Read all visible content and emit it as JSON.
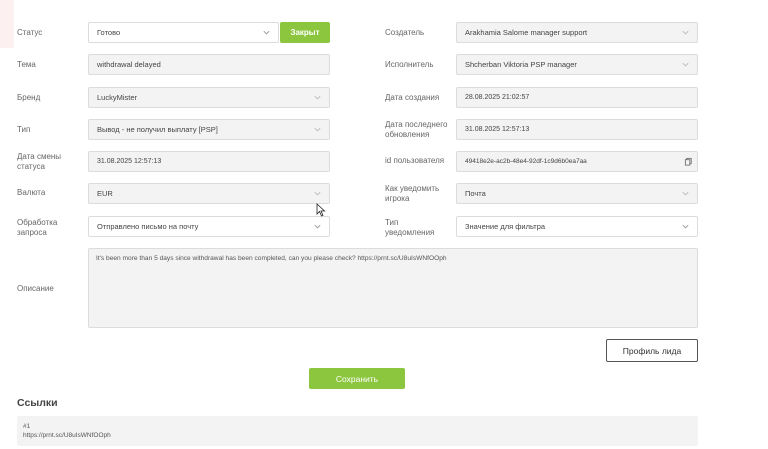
{
  "form": {
    "left": [
      {
        "label": "Статус",
        "value": "Готово",
        "dropdown": true,
        "white": true
      },
      {
        "label": "Тема",
        "value": "withdrawal delayed",
        "dropdown": false,
        "white": false
      },
      {
        "label": "Бренд",
        "value": "LuckyMister",
        "dropdown": true,
        "white": false
      },
      {
        "label": "Тип",
        "value": "Вывод - не получил выплату [PSP]",
        "dropdown": true,
        "white": false
      },
      {
        "label": "Дата смены статуса",
        "value": "31.08.2025 12:57:13",
        "dropdown": false,
        "white": false
      },
      {
        "label": "Валюта",
        "value": "EUR",
        "dropdown": true,
        "white": false
      },
      {
        "label": "Обработка запроса",
        "value": "Отправлено письмо на почту",
        "dropdown": true,
        "white": true
      }
    ],
    "right": [
      {
        "label": "Создатель",
        "value": "Arakhamia Salome manager support",
        "dropdown": true,
        "white": false
      },
      {
        "label": "Исполнитель",
        "value": "Shcherban Viktoria PSP manager",
        "dropdown": true,
        "white": false
      },
      {
        "label": "Дата создания",
        "value": "28.08.2025 21:02:57",
        "dropdown": false,
        "white": false
      },
      {
        "label": "Дата последнего обновления",
        "value": "31.08.2025 12:57:13",
        "dropdown": false,
        "white": false
      },
      {
        "label": "id пользователя",
        "value": "49418e2e-ac2b-48e4-92df-1c9d6b0ea7aa",
        "dropdown": false,
        "white": false,
        "copy": true
      },
      {
        "label": "Как уведомить игрока",
        "value": "Почта",
        "dropdown": true,
        "white": false
      },
      {
        "label": "Тип уведомления",
        "placeholder": "Значение для фильтра",
        "dropdown": true,
        "white": true
      }
    ],
    "close_button": "Закрыт",
    "description_label": "Описание",
    "description_text": "It's been more than 5 days since withdrawal has been completed, can you please check? https://prnt.sc/U8uIsWNfOOph"
  },
  "profile_button": "Профиль лида",
  "save_button": "Сохранить",
  "links": {
    "title": "Ссылки",
    "items": [
      {
        "index": "#1",
        "url": "https://prnt.sc/U8uIsWNfOOph"
      }
    ]
  },
  "colors": {
    "accent": "#8cc63f",
    "field_bg": "#f3f3f3",
    "border": "#dcdcdc"
  }
}
